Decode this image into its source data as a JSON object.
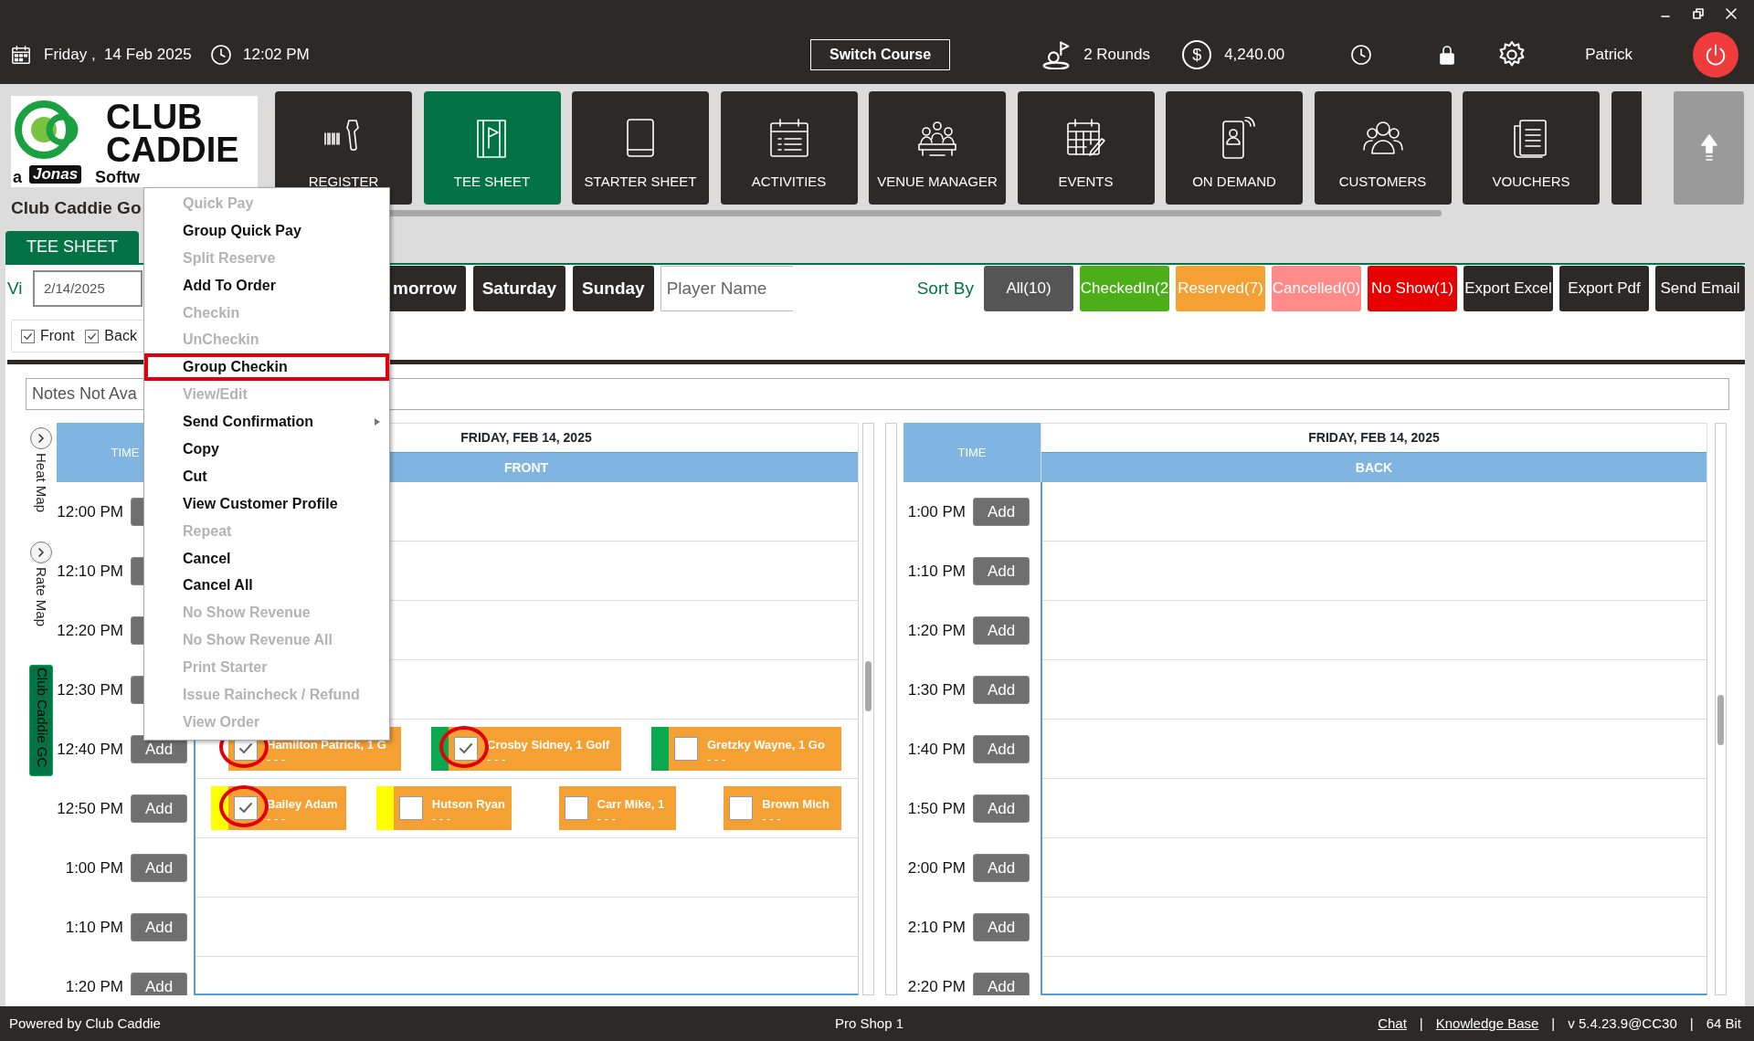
{
  "top_bar": {
    "date": "Friday ,  14 Feb 2025",
    "time": "12:02 PM",
    "switch_course": "Switch Course",
    "rounds": "2 Rounds",
    "currency_symbol": "$",
    "revenue": "4,240.00",
    "user": "Patrick"
  },
  "logo": {
    "line1": "CLUB",
    "line2": "CADDIE",
    "tagline_prefix": "a",
    "tagline_brand": "Jonas",
    "tagline_rest": "Softw"
  },
  "course_name": "Club Caddie Go",
  "nav_tiles": [
    {
      "label": "REGISTER",
      "selected": false
    },
    {
      "label": "TEE SHEET",
      "selected": true
    },
    {
      "label": "STARTER SHEET",
      "selected": false
    },
    {
      "label": "ACTIVITIES",
      "selected": false
    },
    {
      "label": "VENUE MANAGER",
      "selected": false
    },
    {
      "label": "EVENTS",
      "selected": false
    },
    {
      "label": "ON DEMAND",
      "selected": false
    },
    {
      "label": "CUSTOMERS",
      "selected": false
    },
    {
      "label": "VOUCHERS",
      "selected": false
    }
  ],
  "tabs": [
    {
      "label": "TEE SHEET",
      "selected": true
    }
  ],
  "toolbar": {
    "view_label": "Vi",
    "date": "2/14/2025",
    "day_buttons": [
      "morrow",
      "Saturday",
      "Sunday"
    ],
    "player_search": {
      "placeholder": "Player Name"
    },
    "sort_label": "Sort By",
    "filters": [
      {
        "label": "All(10)",
        "color": "#555555"
      },
      {
        "label": "CheckedIn(2",
        "color": "#4caf1a"
      },
      {
        "label": "Reserved(7)",
        "color": "#f4a033"
      },
      {
        "label": "Cancelled(0)",
        "color": "#ff8a8a"
      },
      {
        "label": "No Show(1)",
        "color": "#e60000"
      }
    ],
    "actions": [
      "Export Excel",
      "Export Pdf",
      "Send Email"
    ]
  },
  "nines": [
    {
      "label": "Front",
      "checked": true
    },
    {
      "label": "Back",
      "checked": true
    }
  ],
  "notes": {
    "value": "Notes Not Ava"
  },
  "side_tabs": [
    {
      "label": "Heat Map",
      "kind": "toggle"
    },
    {
      "label": "Rate Map",
      "kind": "toggle"
    },
    {
      "label": "Club Caddie GC",
      "kind": "course"
    }
  ],
  "sheets": [
    {
      "time_header": "TIME",
      "date": "FRIDAY, FEB 14, 2025",
      "nine": "FRONT",
      "rows": [
        {
          "time": "12:00 PM"
        },
        {
          "time": "12:10 PM"
        },
        {
          "time": "12:20 PM"
        },
        {
          "time": "12:30 PM"
        },
        {
          "time": "12:40 PM",
          "add": "Add",
          "bookings": [
            {
              "name": "Hamilton Patrick, 1 G",
              "detail": "- - -",
              "checked": true,
              "color": "#ffffff",
              "circled": true
            },
            {
              "name": "Crosby Sidney, 1 Golf",
              "detail": "- - -",
              "checked": true,
              "color": "#0aa84f",
              "circled": true
            },
            {
              "name": "Gretzky Wayne, 1 Go",
              "detail": "- - -",
              "checked": false,
              "color": "#0aa84f",
              "circled": false
            }
          ]
        },
        {
          "time": "12:50 PM",
          "add": "Add",
          "bookings": [
            {
              "name": "Bailey Adam",
              "detail": "- - -",
              "checked": true,
              "color": "#ffff00",
              "circled": true
            },
            {
              "name": "Hutson Ryan",
              "detail": "- - -",
              "checked": false,
              "color": "#ffff00",
              "circled": false
            },
            {
              "name": "Carr Mike, 1",
              "detail": "- - -",
              "checked": false,
              "color": "#ffffff",
              "circled": false
            },
            {
              "name": "Brown Mich",
              "detail": "- - -",
              "checked": false,
              "color": "#ffffff",
              "circled": false
            }
          ]
        },
        {
          "time": "1:00 PM",
          "add": "Add"
        },
        {
          "time": "1:10 PM",
          "add": "Add"
        },
        {
          "time": "1:20 PM",
          "add": "Add"
        }
      ]
    },
    {
      "time_header": "TIME",
      "date": "FRIDAY, FEB 14, 2025",
      "nine": "BACK",
      "rows": [
        {
          "time": "1:00 PM",
          "add": "Add"
        },
        {
          "time": "1:10 PM",
          "add": "Add"
        },
        {
          "time": "1:20 PM",
          "add": "Add"
        },
        {
          "time": "1:30 PM",
          "add": "Add"
        },
        {
          "time": "1:40 PM",
          "add": "Add"
        },
        {
          "time": "1:50 PM",
          "add": "Add"
        },
        {
          "time": "2:00 PM",
          "add": "Add"
        },
        {
          "time": "2:10 PM",
          "add": "Add"
        },
        {
          "time": "2:20 PM",
          "add": "Add"
        }
      ]
    }
  ],
  "context_menu": {
    "items": [
      {
        "label": "Quick Pay",
        "disabled": true,
        "highlighted": false,
        "submenu": false
      },
      {
        "label": "Group Quick Pay",
        "disabled": false,
        "highlighted": false,
        "submenu": false
      },
      {
        "label": "Split Reserve",
        "disabled": true,
        "highlighted": false,
        "submenu": false
      },
      {
        "label": "Add To Order",
        "disabled": false,
        "highlighted": false,
        "submenu": false
      },
      {
        "label": "Checkin",
        "disabled": true,
        "highlighted": false,
        "submenu": false
      },
      {
        "label": "UnCheckin",
        "disabled": true,
        "highlighted": false,
        "submenu": false
      },
      {
        "label": "Group Checkin",
        "disabled": false,
        "highlighted": true,
        "submenu": false
      },
      {
        "label": "View/Edit",
        "disabled": true,
        "highlighted": false,
        "submenu": false
      },
      {
        "label": "Send Confirmation",
        "disabled": false,
        "highlighted": false,
        "submenu": true
      },
      {
        "label": "Copy",
        "disabled": false,
        "highlighted": false,
        "submenu": false
      },
      {
        "label": "Cut",
        "disabled": false,
        "highlighted": false,
        "submenu": false
      },
      {
        "label": "View Customer Profile",
        "disabled": false,
        "highlighted": false,
        "submenu": false
      },
      {
        "label": "Repeat",
        "disabled": true,
        "highlighted": false,
        "submenu": false
      },
      {
        "label": "Cancel",
        "disabled": false,
        "highlighted": false,
        "submenu": false
      },
      {
        "label": "Cancel All",
        "disabled": false,
        "highlighted": false,
        "submenu": false
      },
      {
        "label": "No Show Revenue",
        "disabled": true,
        "highlighted": false,
        "submenu": false
      },
      {
        "label": "No Show Revenue All",
        "disabled": true,
        "highlighted": false,
        "submenu": false
      },
      {
        "label": "Print Starter",
        "disabled": true,
        "highlighted": false,
        "submenu": false
      },
      {
        "label": "Issue Raincheck / Refund",
        "disabled": true,
        "highlighted": false,
        "submenu": false
      },
      {
        "label": "View Order",
        "disabled": true,
        "highlighted": false,
        "submenu": false
      }
    ]
  },
  "status_bar": {
    "left": "Powered by Club Caddie",
    "center": "Pro Shop 1",
    "right": [
      {
        "text": "Chat",
        "kind": "link"
      },
      {
        "text": "|",
        "kind": "separator"
      },
      {
        "text": "Knowledge Base",
        "kind": "link"
      },
      {
        "text": "|",
        "kind": "separator"
      },
      {
        "text": "v 5.4.23.9@CC30",
        "kind": "text"
      },
      {
        "text": "|",
        "kind": "separator"
      },
      {
        "text": "64 Bit",
        "kind": "text"
      }
    ]
  }
}
